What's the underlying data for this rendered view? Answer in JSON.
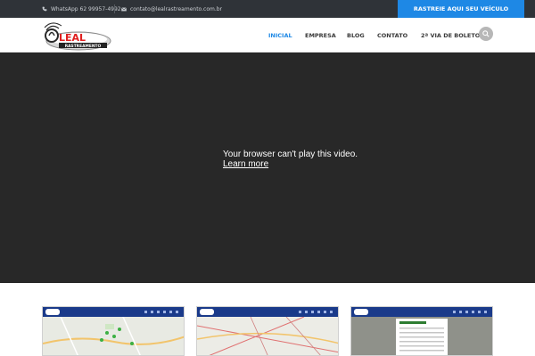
{
  "topbar": {
    "whatsapp": "WhatsApp 62 99957-4992",
    "email": "contato@lealrastreamento.com.br",
    "track_button": "RASTREIE AQUI SEU VEÍCULO"
  },
  "logo": {
    "text": "LEAL",
    "subtext": "RASTREAMENTO"
  },
  "nav": {
    "items": [
      {
        "label": "INICIAL",
        "active": true
      },
      {
        "label": "EMPRESA",
        "active": false
      },
      {
        "label": "BLOG",
        "active": false
      },
      {
        "label": "CONTATO",
        "active": false
      },
      {
        "label": "2ª VIA DE BOLETO",
        "active": false
      }
    ]
  },
  "video": {
    "message": "Your browser can't play this video.",
    "learn_more": "Learn more"
  },
  "colors": {
    "accent": "#1e88e5",
    "topbar": "#2f3338",
    "video_bg": "#282828"
  },
  "icons": {
    "whatsapp": "phone-icon",
    "email": "envelope-icon",
    "search": "search-icon"
  }
}
